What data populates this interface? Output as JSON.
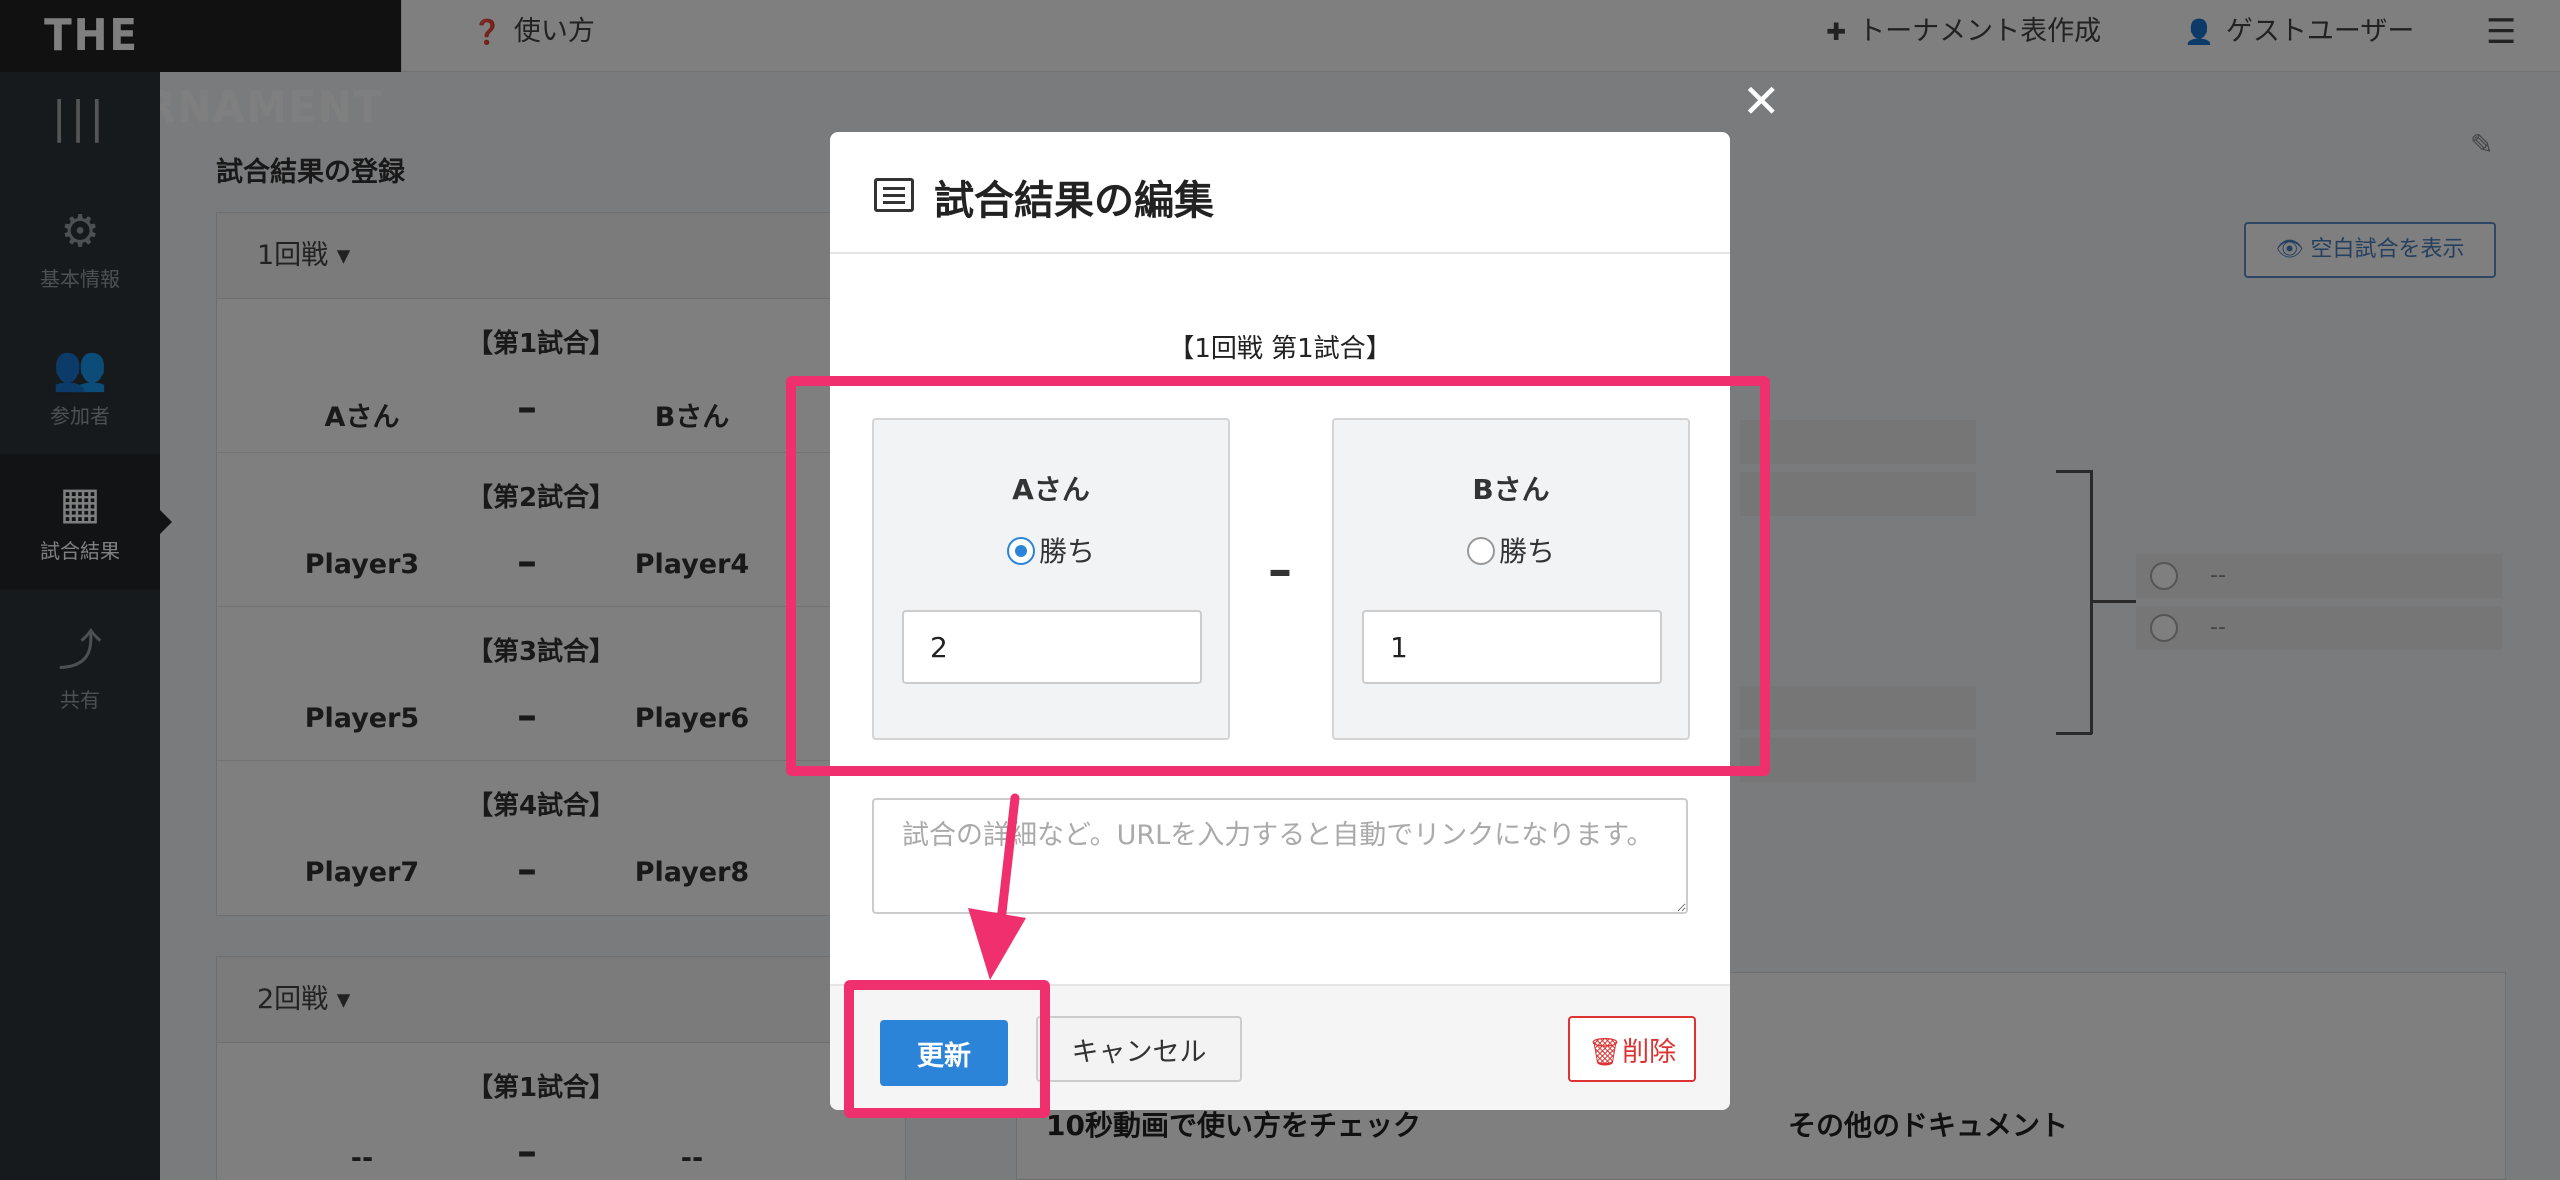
{
  "header": {
    "logo": "THE TOURNAMENT",
    "help_label": "使い方",
    "create_label": "トーナメント表作成",
    "user_label": "ゲストユーザー"
  },
  "sidebar": {
    "items": [
      {
        "label": "基本情報",
        "icon": "gear-icon"
      },
      {
        "label": "参加者",
        "icon": "users-icon"
      },
      {
        "label": "試合結果",
        "icon": "table-icon",
        "active": true
      },
      {
        "label": "共有",
        "icon": "share-icon"
      }
    ]
  },
  "main": {
    "title": "試合結果の登録",
    "rounds": [
      {
        "label": "1回戦",
        "matches": [
          {
            "title": "【第1試合】",
            "p1": "Aさん",
            "p2": "Bさん"
          },
          {
            "title": "【第2試合】",
            "p1": "Player3",
            "p2": "Player4"
          },
          {
            "title": "【第3試合】",
            "p1": "Player5",
            "p2": "Player6"
          },
          {
            "title": "【第4試合】",
            "p1": "Player7",
            "p2": "Player8"
          }
        ]
      },
      {
        "label": "2回戦",
        "matches": [
          {
            "title": "【第1試合】",
            "p1": "--",
            "p2": "--"
          }
        ]
      }
    ],
    "dash": "–"
  },
  "right": {
    "show_blank_label": "空白試合を表示",
    "slot_placeholder": "--",
    "docs_heading_1": "10秒動画で使い方をチェック",
    "docs_heading_2": "その他のドキュメント"
  },
  "modal": {
    "title": "試合結果の編集",
    "match_caption": "【1回戦 第1試合】",
    "player_a": {
      "name": "Aさん",
      "win_label": "勝ち",
      "selected": true,
      "score": "2"
    },
    "player_b": {
      "name": "Bさん",
      "win_label": "勝ち",
      "selected": false,
      "score": "1"
    },
    "separator": "–",
    "notes_placeholder": "試合の詳細など。URLを入力すると自動でリンクになります。",
    "update_label": "更新",
    "cancel_label": "キャンセル",
    "delete_label": "削除"
  },
  "colors": {
    "highlight": "#f0306e",
    "primary": "#2b84d8",
    "danger": "#dd3333"
  }
}
